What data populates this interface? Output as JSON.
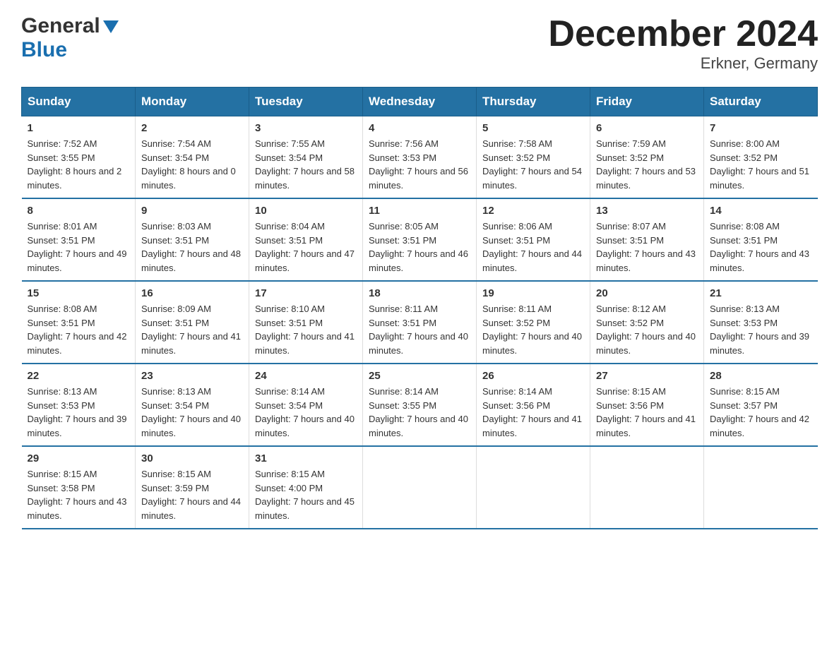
{
  "header": {
    "logo_general": "General",
    "logo_blue": "Blue",
    "title": "December 2024",
    "subtitle": "Erkner, Germany"
  },
  "columns": [
    "Sunday",
    "Monday",
    "Tuesday",
    "Wednesday",
    "Thursday",
    "Friday",
    "Saturday"
  ],
  "weeks": [
    [
      {
        "day": "1",
        "sunrise": "7:52 AM",
        "sunset": "3:55 PM",
        "daylight": "8 hours and 2 minutes."
      },
      {
        "day": "2",
        "sunrise": "7:54 AM",
        "sunset": "3:54 PM",
        "daylight": "8 hours and 0 minutes."
      },
      {
        "day": "3",
        "sunrise": "7:55 AM",
        "sunset": "3:54 PM",
        "daylight": "7 hours and 58 minutes."
      },
      {
        "day": "4",
        "sunrise": "7:56 AM",
        "sunset": "3:53 PM",
        "daylight": "7 hours and 56 minutes."
      },
      {
        "day": "5",
        "sunrise": "7:58 AM",
        "sunset": "3:52 PM",
        "daylight": "7 hours and 54 minutes."
      },
      {
        "day": "6",
        "sunrise": "7:59 AM",
        "sunset": "3:52 PM",
        "daylight": "7 hours and 53 minutes."
      },
      {
        "day": "7",
        "sunrise": "8:00 AM",
        "sunset": "3:52 PM",
        "daylight": "7 hours and 51 minutes."
      }
    ],
    [
      {
        "day": "8",
        "sunrise": "8:01 AM",
        "sunset": "3:51 PM",
        "daylight": "7 hours and 49 minutes."
      },
      {
        "day": "9",
        "sunrise": "8:03 AM",
        "sunset": "3:51 PM",
        "daylight": "7 hours and 48 minutes."
      },
      {
        "day": "10",
        "sunrise": "8:04 AM",
        "sunset": "3:51 PM",
        "daylight": "7 hours and 47 minutes."
      },
      {
        "day": "11",
        "sunrise": "8:05 AM",
        "sunset": "3:51 PM",
        "daylight": "7 hours and 46 minutes."
      },
      {
        "day": "12",
        "sunrise": "8:06 AM",
        "sunset": "3:51 PM",
        "daylight": "7 hours and 44 minutes."
      },
      {
        "day": "13",
        "sunrise": "8:07 AM",
        "sunset": "3:51 PM",
        "daylight": "7 hours and 43 minutes."
      },
      {
        "day": "14",
        "sunrise": "8:08 AM",
        "sunset": "3:51 PM",
        "daylight": "7 hours and 43 minutes."
      }
    ],
    [
      {
        "day": "15",
        "sunrise": "8:08 AM",
        "sunset": "3:51 PM",
        "daylight": "7 hours and 42 minutes."
      },
      {
        "day": "16",
        "sunrise": "8:09 AM",
        "sunset": "3:51 PM",
        "daylight": "7 hours and 41 minutes."
      },
      {
        "day": "17",
        "sunrise": "8:10 AM",
        "sunset": "3:51 PM",
        "daylight": "7 hours and 41 minutes."
      },
      {
        "day": "18",
        "sunrise": "8:11 AM",
        "sunset": "3:51 PM",
        "daylight": "7 hours and 40 minutes."
      },
      {
        "day": "19",
        "sunrise": "8:11 AM",
        "sunset": "3:52 PM",
        "daylight": "7 hours and 40 minutes."
      },
      {
        "day": "20",
        "sunrise": "8:12 AM",
        "sunset": "3:52 PM",
        "daylight": "7 hours and 40 minutes."
      },
      {
        "day": "21",
        "sunrise": "8:13 AM",
        "sunset": "3:53 PM",
        "daylight": "7 hours and 39 minutes."
      }
    ],
    [
      {
        "day": "22",
        "sunrise": "8:13 AM",
        "sunset": "3:53 PM",
        "daylight": "7 hours and 39 minutes."
      },
      {
        "day": "23",
        "sunrise": "8:13 AM",
        "sunset": "3:54 PM",
        "daylight": "7 hours and 40 minutes."
      },
      {
        "day": "24",
        "sunrise": "8:14 AM",
        "sunset": "3:54 PM",
        "daylight": "7 hours and 40 minutes."
      },
      {
        "day": "25",
        "sunrise": "8:14 AM",
        "sunset": "3:55 PM",
        "daylight": "7 hours and 40 minutes."
      },
      {
        "day": "26",
        "sunrise": "8:14 AM",
        "sunset": "3:56 PM",
        "daylight": "7 hours and 41 minutes."
      },
      {
        "day": "27",
        "sunrise": "8:15 AM",
        "sunset": "3:56 PM",
        "daylight": "7 hours and 41 minutes."
      },
      {
        "day": "28",
        "sunrise": "8:15 AM",
        "sunset": "3:57 PM",
        "daylight": "7 hours and 42 minutes."
      }
    ],
    [
      {
        "day": "29",
        "sunrise": "8:15 AM",
        "sunset": "3:58 PM",
        "daylight": "7 hours and 43 minutes."
      },
      {
        "day": "30",
        "sunrise": "8:15 AM",
        "sunset": "3:59 PM",
        "daylight": "7 hours and 44 minutes."
      },
      {
        "day": "31",
        "sunrise": "8:15 AM",
        "sunset": "4:00 PM",
        "daylight": "7 hours and 45 minutes."
      },
      {
        "day": "",
        "sunrise": "",
        "sunset": "",
        "daylight": ""
      },
      {
        "day": "",
        "sunrise": "",
        "sunset": "",
        "daylight": ""
      },
      {
        "day": "",
        "sunrise": "",
        "sunset": "",
        "daylight": ""
      },
      {
        "day": "",
        "sunrise": "",
        "sunset": "",
        "daylight": ""
      }
    ]
  ],
  "sunrise_label": "Sunrise:",
  "sunset_label": "Sunset:",
  "daylight_label": "Daylight:"
}
